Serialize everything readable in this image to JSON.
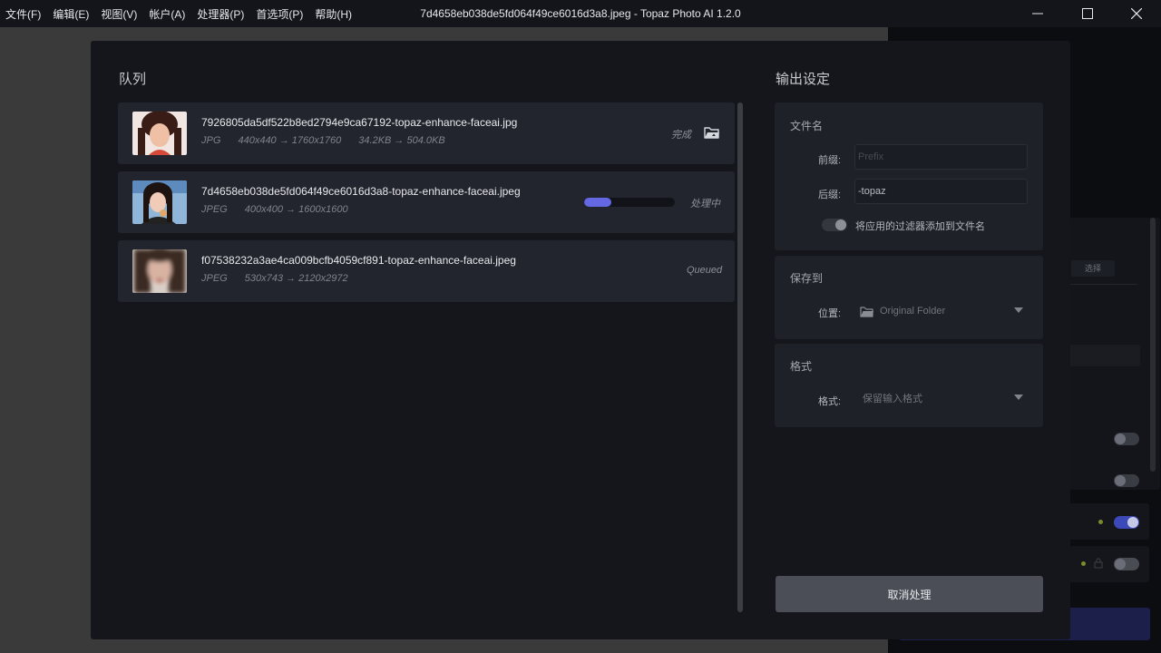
{
  "menu": [
    "文件(F)",
    "编辑(E)",
    "视图(V)",
    "帐户(A)",
    "处理器(P)",
    "首选项(P)",
    "帮助(H)"
  ],
  "window": {
    "title": "7d4658eb038de5fd064f49ce6016d3a8.jpeg - Topaz Photo AI 1.2.0"
  },
  "background": {
    "select_label": "选择"
  },
  "queue": {
    "title": "队列",
    "items": [
      {
        "filename": "7926805da5df522b8ed2794e9ca67192-topaz-enhance-faceai.jpg",
        "format": "JPG",
        "dimensions": "440x440 → 1760x1760",
        "size": "34.2KB → 504.0KB",
        "status": "完成",
        "has_folder_icon": true
      },
      {
        "filename": "7d4658eb038de5fd064f49ce6016d3a8-topaz-enhance-faceai.jpeg",
        "format": "JPEG",
        "dimensions": "400x400 → 1600x1600",
        "status": "处理中",
        "progress": 0.3
      },
      {
        "filename": "f07538232a3ae4ca009bcfb4059cf891-topaz-enhance-faceai.jpeg",
        "format": "JPEG",
        "dimensions": "530x743 → 2120x2972",
        "status": "Queued"
      }
    ]
  },
  "output": {
    "title": "输出设定",
    "filename_section": {
      "title": "文件名",
      "prefix_label": "前缀:",
      "prefix_placeholder": "Prefix",
      "suffix_label": "后缀:",
      "suffix_value": "-topaz",
      "toggle_label": "将应用的过滤器添加到文件名",
      "toggle_on": false
    },
    "save_section": {
      "title": "保存到",
      "location_label": "位置:",
      "location_value": "Original Folder"
    },
    "format_section": {
      "title": "格式",
      "format_label": "格式:",
      "format_value": "保留输入格式"
    }
  },
  "cancel_button": "取消处理",
  "colors": {
    "accent": "#6468e2",
    "modal_bg": "#15161c",
    "card_bg": "#22252d"
  }
}
